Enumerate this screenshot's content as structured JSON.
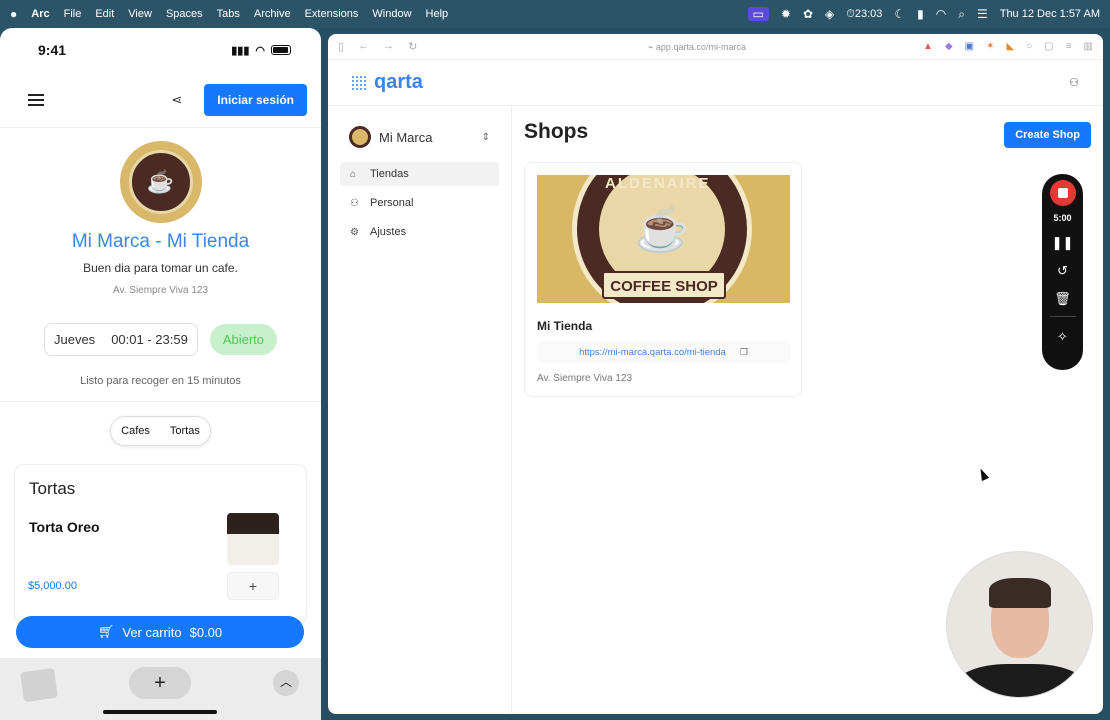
{
  "menubar": {
    "app": "Arc",
    "items": [
      "File",
      "Edit",
      "View",
      "Spaces",
      "Tabs",
      "Archive",
      "Extensions",
      "Window",
      "Help"
    ],
    "timer": "23:03",
    "datetime": "Thu 12 Dec  1:57 AM"
  },
  "phone": {
    "time": "9:41",
    "login_label": "Iniciar sesión",
    "brand_title": "Mi Marca - Mi Tienda",
    "brand_subtitle": "Buen dia para tomar un cafe.",
    "address": "Av. Siempre Viva 123",
    "day": "Jueves",
    "hours": "00:01 - 23:59",
    "status": "Abierto",
    "pickup": "Listo para recoger en 15 minutos",
    "categories": [
      "Cafes",
      "Tortas"
    ],
    "section_title": "Tortas",
    "product": {
      "name": "Torta Oreo",
      "price": "$5,000.00",
      "add": "+"
    },
    "cart_label": "Ver carrito",
    "cart_total": "$0.00",
    "bottom_plus": "+"
  },
  "browser": {
    "url": "app.qarta.co/mi-marca",
    "logo": "qarta",
    "brand_selector": "Mi Marca",
    "nav": [
      {
        "label": "Tiendas",
        "icon": "store-icon"
      },
      {
        "label": "Personal",
        "icon": "user-icon"
      },
      {
        "label": "Ajustes",
        "icon": "gear-icon"
      }
    ],
    "page_title": "Shops",
    "create_label": "Create Shop",
    "shop": {
      "banner_top": "ALDENAIRE",
      "banner_ribbon": "COFFEE SHOP",
      "name": "Mi Tienda",
      "link": "https://mi-marca.qarta.co/mi-tienda",
      "address": "Av. Siempre Viva 123"
    }
  },
  "recorder": {
    "time": "5:00"
  },
  "colors": {
    "primary": "#1677ff",
    "accent_blue": "#3a86e6",
    "open_green": "#52c45b",
    "stop_red": "#e53935"
  }
}
